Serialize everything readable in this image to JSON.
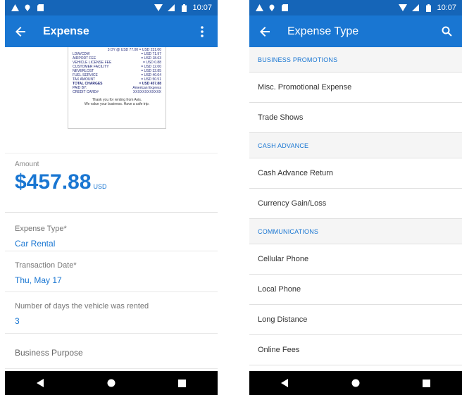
{
  "status_bar": {
    "time": "10:07"
  },
  "expense_screen": {
    "title": "Expense",
    "receipt": {
      "top_line": "3 DY @ USD 77.00 = USD 231.00",
      "rows": [
        {
          "label": "LDW/CDW",
          "value": "= USD 71.97"
        },
        {
          "label": "AIRPORT FEE",
          "value": "= USD 18.63"
        },
        {
          "label": "VEHICLE LICENSE FEE",
          "value": "= USD 0.88"
        },
        {
          "label": "CUSTOMER FACILITY",
          "value": "= USD 12.00"
        },
        {
          "label": "NEVERLOST",
          "value": "= USD 32.85"
        },
        {
          "label": "FUEL SERVICE",
          "value": "= USD 40.04"
        },
        {
          "label": "TAX AMOUNT",
          "value": "= USD 50.51"
        }
      ],
      "total_label": "TOTAL CHARGES",
      "total_value": "= USD 457.88",
      "paid_by_label": "PAID BY:",
      "paid_by_value": "American Express",
      "card_label": "CREDIT CARD#",
      "card_value": "XXXXXXXXXXXX",
      "thanks_1": "Thank you for renting from Avis.",
      "thanks_2": "We value your business. Have a safe trip."
    },
    "amount_label": "Amount",
    "amount_value": "$457.88",
    "amount_currency": "USD",
    "fields": [
      {
        "label": "Expense Type*",
        "value": "Car Rental"
      },
      {
        "label": "Transaction Date*",
        "value": "Thu, May 17"
      },
      {
        "label": "Number of days the vehicle was rented",
        "value": "3"
      },
      {
        "label": "Business Purpose",
        "value": ""
      }
    ]
  },
  "expense_type_screen": {
    "title": "Expense Type",
    "sections": [
      {
        "header": "BUSINESS PROMOTIONS",
        "items": [
          "Misc. Promotional Expense",
          "Trade Shows"
        ]
      },
      {
        "header": "CASH ADVANCE",
        "items": [
          "Cash Advance Return",
          "Currency Gain/Loss"
        ]
      },
      {
        "header": "COMMUNICATIONS",
        "items": [
          "Cellular Phone",
          "Local Phone",
          "Long Distance",
          "Online Fees"
        ]
      }
    ]
  },
  "colors": {
    "primary": "#1976d2",
    "status_bar": "#1565b8"
  },
  "icons": {
    "back": "arrow-left-icon",
    "menu": "more-vert-icon",
    "search": "search-icon",
    "nav": [
      "back-triangle-icon",
      "home-circle-icon",
      "recents-square-icon"
    ]
  }
}
